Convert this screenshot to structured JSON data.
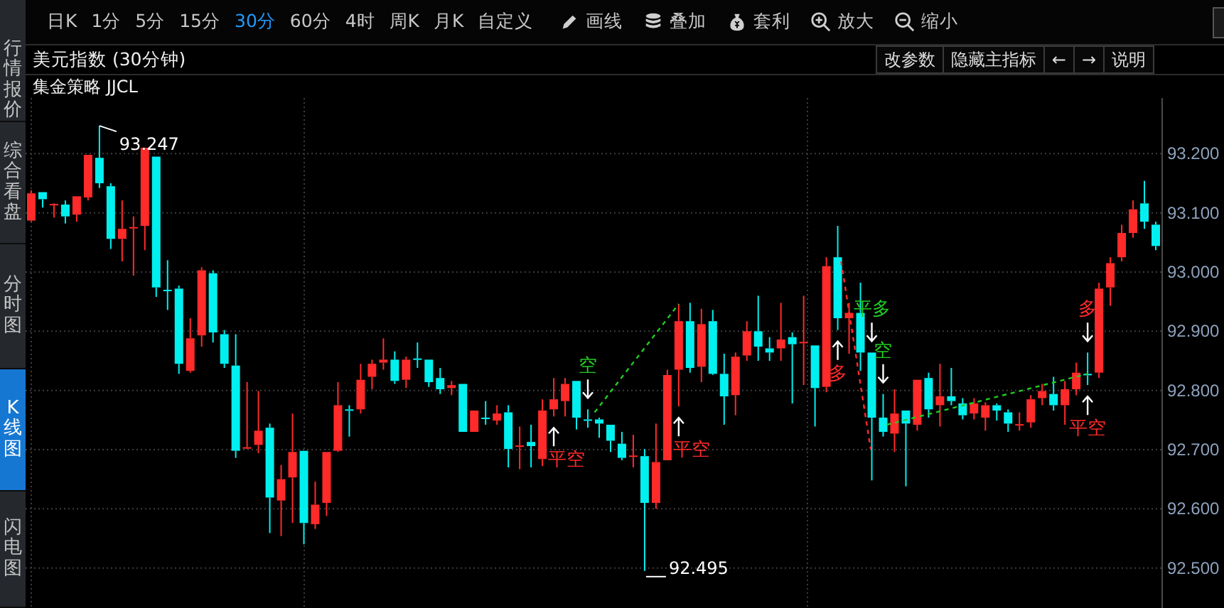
{
  "sidebar": {
    "tabs": [
      {
        "label": "行情报价",
        "selected": false
      },
      {
        "label": "综合看盘",
        "selected": false
      },
      {
        "label": "分时图",
        "selected": false
      },
      {
        "label": "K线图",
        "selected": true
      },
      {
        "label": "闪电图",
        "selected": false
      }
    ]
  },
  "toolbar": {
    "periods": [
      {
        "label": "日K",
        "selected": false
      },
      {
        "label": "1分",
        "selected": false
      },
      {
        "label": "5分",
        "selected": false
      },
      {
        "label": "15分",
        "selected": false
      },
      {
        "label": "30分",
        "selected": true
      },
      {
        "label": "60分",
        "selected": false
      },
      {
        "label": "4时",
        "selected": false
      },
      {
        "label": "周K",
        "selected": false
      },
      {
        "label": "月K",
        "selected": false
      },
      {
        "label": "自定义",
        "selected": false
      }
    ],
    "tools": [
      {
        "label": "画线",
        "kind": "pencil"
      },
      {
        "label": "叠加",
        "kind": "stack"
      },
      {
        "label": "套利",
        "kind": "bag"
      },
      {
        "label": "放大",
        "kind": "zoom_in"
      },
      {
        "label": "缩小",
        "kind": "zoom_out"
      }
    ]
  },
  "chart_header": {
    "title": "美元指数 (30分钟)",
    "buttons": [
      "改参数",
      "隐藏主指标",
      "←",
      "→",
      "说明"
    ],
    "indicator": "集金策略 JJCL"
  },
  "chart": {
    "signals": [
      {
        "text": "平空",
        "color": "#ff2a2a"
      },
      {
        "text": "空",
        "color": "#22cc22"
      },
      {
        "text": "平空",
        "color": "#ff2a2a"
      },
      {
        "text": "多",
        "color": "#ff2a2a"
      },
      {
        "text": "平多",
        "color": "#22cc22"
      },
      {
        "text": "空",
        "color": "#22cc22"
      },
      {
        "text": "多",
        "color": "#ff2a2a"
      },
      {
        "text": "平空",
        "color": "#ff2a2a"
      }
    ],
    "chart_data": {
      "type": "candlestick",
      "ylim": [
        92.43,
        93.294
      ],
      "grid": true,
      "yticks": [
        {
          "value": 93.2,
          "label": "93.200"
        },
        {
          "value": 93.1,
          "label": "93.100"
        },
        {
          "value": 93.0,
          "label": "93.000"
        },
        {
          "value": 92.9,
          "label": "92.900"
        },
        {
          "value": 92.8,
          "label": "92.800"
        },
        {
          "value": 92.7,
          "label": "92.700"
        },
        {
          "value": 92.6,
          "label": "92.600"
        },
        {
          "value": 92.5,
          "label": "92.500"
        }
      ],
      "categories": [
        null,
        null,
        null,
        null,
        null,
        null,
        null,
        null,
        null,
        null,
        null,
        null,
        null,
        null,
        null,
        null,
        null,
        null,
        null,
        null,
        null,
        null,
        null,
        null,
        null,
        null,
        null,
        null,
        null,
        null,
        null,
        null,
        null,
        null,
        null,
        null,
        null,
        null,
        null,
        null,
        null,
        null,
        null,
        null,
        null,
        null,
        null,
        null,
        null,
        null,
        null,
        null,
        null,
        null,
        null,
        null,
        null,
        null,
        null,
        null,
        null,
        null,
        null,
        null,
        null,
        null,
        null,
        null,
        null,
        null,
        null,
        null,
        null,
        null,
        null,
        null,
        null,
        null,
        null,
        null,
        null,
        null,
        null,
        null,
        null,
        null,
        null,
        null,
        null,
        null,
        null,
        null,
        null,
        null,
        null,
        null,
        null,
        null,
        null,
        null
      ],
      "ohlc": [
        [
          93.087,
          93.138,
          93.085,
          93.133
        ],
        [
          93.135,
          93.135,
          93.109,
          93.123
        ],
        [
          93.114,
          93.116,
          93.092,
          93.115
        ],
        [
          93.114,
          93.121,
          93.082,
          93.094
        ],
        [
          93.097,
          93.128,
          93.085,
          93.128
        ],
        [
          93.126,
          93.198,
          93.121,
          93.198
        ],
        [
          93.193,
          93.247,
          93.142,
          93.15
        ],
        [
          93.145,
          93.15,
          93.039,
          93.056
        ],
        [
          93.056,
          93.121,
          93.018,
          93.073
        ],
        [
          93.075,
          93.094,
          92.994,
          93.076
        ],
        [
          93.078,
          93.21,
          93.037,
          93.21
        ],
        [
          93.195,
          93.195,
          92.958,
          92.974
        ],
        [
          92.97,
          93.02,
          92.936,
          92.969
        ],
        [
          92.972,
          92.977,
          92.828,
          92.845
        ],
        [
          92.833,
          92.922,
          92.83,
          92.888
        ],
        [
          92.893,
          93.008,
          92.874,
          93.003
        ],
        [
          92.998,
          93.003,
          92.881,
          92.898
        ],
        [
          92.895,
          92.902,
          92.838,
          92.845
        ],
        [
          92.842,
          92.895,
          92.686,
          92.698
        ],
        [
          92.703,
          92.814,
          92.701,
          92.704
        ],
        [
          92.708,
          92.799,
          92.694,
          92.732
        ],
        [
          92.737,
          92.744,
          92.559,
          92.619
        ],
        [
          92.614,
          92.674,
          92.554,
          92.65
        ],
        [
          92.653,
          92.761,
          92.576,
          92.696
        ],
        [
          92.698,
          92.698,
          92.54,
          92.576
        ],
        [
          92.574,
          92.646,
          92.566,
          92.607
        ],
        [
          92.61,
          92.696,
          92.588,
          92.696
        ],
        [
          92.698,
          92.814,
          92.696,
          92.775
        ],
        [
          92.768,
          92.775,
          92.722,
          92.767
        ],
        [
          92.768,
          92.845,
          92.761,
          92.818
        ],
        [
          92.823,
          92.852,
          92.802,
          92.845
        ],
        [
          92.847,
          92.888,
          92.835,
          92.852
        ],
        [
          92.852,
          92.866,
          92.811,
          92.816
        ],
        [
          92.818,
          92.857,
          92.804,
          92.852
        ],
        [
          92.854,
          92.881,
          92.838,
          92.853
        ],
        [
          92.852,
          92.852,
          92.806,
          92.814
        ],
        [
          92.821,
          92.838,
          92.794,
          92.802
        ],
        [
          92.804,
          92.816,
          92.792,
          92.809
        ],
        [
          92.811,
          92.811,
          92.73,
          92.73
        ],
        [
          92.73,
          92.766,
          92.73,
          92.766
        ],
        [
          92.754,
          92.782,
          92.742,
          92.753
        ],
        [
          92.749,
          92.775,
          92.742,
          92.761
        ],
        [
          92.763,
          92.775,
          92.67,
          92.701
        ],
        [
          92.706,
          92.739,
          92.667,
          92.707
        ],
        [
          92.713,
          92.742,
          92.67,
          92.706
        ],
        [
          92.684,
          92.785,
          92.672,
          92.766
        ],
        [
          92.768,
          92.821,
          92.756,
          92.785
        ],
        [
          92.782,
          92.821,
          92.756,
          92.811
        ],
        [
          92.816,
          92.816,
          92.734,
          92.754
        ],
        [
          92.751,
          92.768,
          92.737,
          92.75
        ],
        [
          92.751,
          92.754,
          92.72,
          92.744
        ],
        [
          92.742,
          92.742,
          92.696,
          92.715
        ],
        [
          92.71,
          92.73,
          92.682,
          92.686
        ],
        [
          92.689,
          92.725,
          92.67,
          92.69
        ],
        [
          92.689,
          92.701,
          92.495,
          92.61
        ],
        [
          92.61,
          92.744,
          92.6,
          92.679
        ],
        [
          92.682,
          92.835,
          92.682,
          92.826
        ],
        [
          92.835,
          92.946,
          92.773,
          92.917
        ],
        [
          92.917,
          92.948,
          92.83,
          92.838
        ],
        [
          92.84,
          92.938,
          92.814,
          92.912
        ],
        [
          92.917,
          92.936,
          92.826,
          92.828
        ],
        [
          92.828,
          92.862,
          92.742,
          92.79
        ],
        [
          92.792,
          92.864,
          92.758,
          92.857
        ],
        [
          92.859,
          92.917,
          92.85,
          92.9
        ],
        [
          92.9,
          92.96,
          92.85,
          92.874
        ],
        [
          92.871,
          92.89,
          92.85,
          92.864
        ],
        [
          92.871,
          92.948,
          92.85,
          92.886
        ],
        [
          92.89,
          92.898,
          92.778,
          92.878
        ],
        [
          92.881,
          92.96,
          92.809,
          92.882
        ],
        [
          92.876,
          92.876,
          92.739,
          92.804
        ],
        [
          92.806,
          93.025,
          92.797,
          93.01
        ],
        [
          93.025,
          93.078,
          92.902,
          92.922
        ],
        [
          92.922,
          92.948,
          92.862,
          92.931
        ],
        [
          92.931,
          92.982,
          92.833,
          92.864
        ],
        [
          92.864,
          92.864,
          92.648,
          92.754
        ],
        [
          92.754,
          92.794,
          92.722,
          92.73
        ],
        [
          92.727,
          92.802,
          92.696,
          92.761
        ],
        [
          92.766,
          92.766,
          92.638,
          92.744
        ],
        [
          92.742,
          92.818,
          92.732,
          92.818
        ],
        [
          92.821,
          92.83,
          92.754,
          92.768
        ],
        [
          92.775,
          92.845,
          92.739,
          92.79
        ],
        [
          92.79,
          92.838,
          92.775,
          92.782
        ],
        [
          92.778,
          92.787,
          92.751,
          92.758
        ],
        [
          92.761,
          92.787,
          92.751,
          92.778
        ],
        [
          92.754,
          92.78,
          92.732,
          92.775
        ],
        [
          92.775,
          92.778,
          92.749,
          92.766
        ],
        [
          92.763,
          92.768,
          92.73,
          92.744
        ],
        [
          92.742,
          92.763,
          92.732,
          92.743
        ],
        [
          92.746,
          92.792,
          92.737,
          92.785
        ],
        [
          92.787,
          92.811,
          92.775,
          92.799
        ],
        [
          92.794,
          92.823,
          92.766,
          92.775
        ],
        [
          92.775,
          92.816,
          92.742,
          92.802
        ],
        [
          92.802,
          92.847,
          92.792,
          92.83
        ],
        [
          92.828,
          92.864,
          92.809,
          92.827
        ],
        [
          92.83,
          92.982,
          92.821,
          92.972
        ],
        [
          92.974,
          93.025,
          92.943,
          93.015
        ],
        [
          93.025,
          93.08,
          93.018,
          93.066
        ],
        [
          93.066,
          93.121,
          93.058,
          93.106
        ],
        [
          93.116,
          93.154,
          93.073,
          93.085
        ],
        [
          93.08,
          93.085,
          93.037,
          93.044
        ]
      ],
      "annotations": [
        "93.247",
        "92.495"
      ]
    }
  }
}
